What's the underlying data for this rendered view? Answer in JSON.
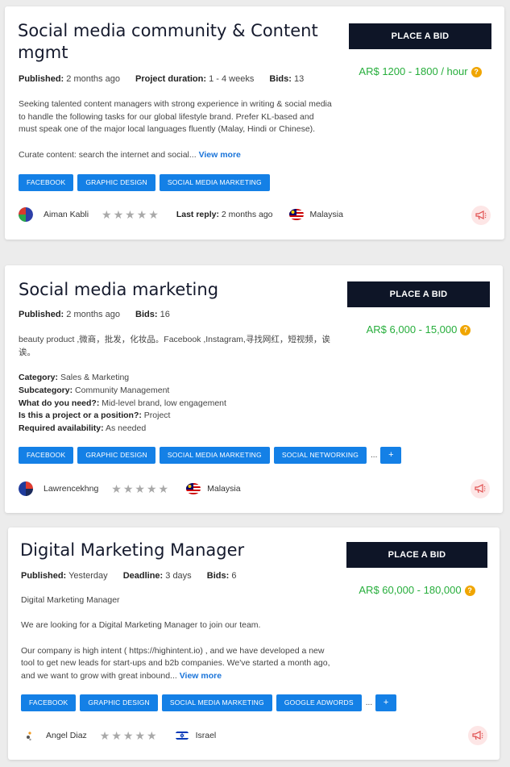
{
  "colors": {
    "page_bg": "#ececec",
    "tag_blue": "#1480e6",
    "bid_button": "#0e1527",
    "price_green": "#27ae3c",
    "help_orange": "#f0a500",
    "link_blue": "#1a74d9",
    "report_red": "#e05050"
  },
  "cards": [
    {
      "title_line1": "Social media community & Content",
      "title_line2": "mgmt",
      "published_label": "Published:",
      "published_value": "2 months ago",
      "duration_label": "Project duration:",
      "duration_value": "1 - 4 weeks",
      "bids_label": "Bids:",
      "bids_value": "13",
      "desc_lines": [
        "Seeking talented content managers with strong experience in writing & social media",
        "to handle the following tasks for our global lifestyle brand. Prefer KL-based and",
        "must speak one of the major local languages fluently (Malay, Hindi or Chinese)."
      ],
      "desc_tail": "Curate content: search the internet and social...",
      "view_more": "View more",
      "tags": [
        "FACEBOOK",
        "GRAPHIC DESIGN",
        "SOCIAL MEDIA MARKETING"
      ],
      "user": "Aiman Kabli",
      "rating_stars": 5,
      "rating_value": 0,
      "last_reply_label": "Last reply:",
      "last_reply_value": "2 months ago",
      "country": "Malaysia",
      "bid_button": "PLACE A BID",
      "price": "AR$ 1200 - 1800 / hour",
      "help_icon": "?"
    },
    {
      "title": "Social media marketing",
      "published_label": "Published:",
      "published_value": "2 months ago",
      "bids_label": "Bids:",
      "bids_value": "16",
      "desc_line1": "beauty product ,微商，批发，化妆品。Facebook ,Instagram,寻找网红，短视频，诶",
      "desc_line2": "诶。",
      "details": [
        {
          "label": "Category:",
          "value": "Sales & Marketing"
        },
        {
          "label": "Subcategory:",
          "value": "Community Management"
        },
        {
          "label": "What do you need?:",
          "value": "Mid-level brand, low engagement"
        },
        {
          "label": "Is this a project or a position?:",
          "value": "Project"
        },
        {
          "label": "Required availability:",
          "value": "As needed"
        }
      ],
      "tags": [
        "FACEBOOK",
        "GRAPHIC DESIGN",
        "SOCIAL MEDIA MARKETING",
        "SOCIAL NETWORKING"
      ],
      "ellipsis": "...",
      "more_tags": "+",
      "user": "Lawrencekhng",
      "rating_stars": 5,
      "rating_value": 0,
      "country": "Malaysia",
      "bid_button": "PLACE A BID",
      "price": "AR$ 6,000 - 15,000",
      "help_icon": "?"
    },
    {
      "title": "Digital Marketing Manager",
      "published_label": "Published:",
      "published_value": "Yesterday",
      "deadline_label": "Deadline:",
      "deadline_value": "3 days",
      "bids_label": "Bids:",
      "bids_value": "6",
      "desc_p1": "Digital Marketing Manager",
      "desc_p2": "We are looking for a Digital Marketing Manager to join our team.",
      "desc_p3_line1": "Our company is high intent ( https://highintent.io) , and we have developed a new",
      "desc_p3_line2": "tool to get new leads for start-ups and b2b companies. We've started a month ago,",
      "desc_p3_line3": "and we want to grow with great inbound...",
      "view_more": "View more",
      "tags": [
        "FACEBOOK",
        "GRAPHIC DESIGN",
        "SOCIAL MEDIA MARKETING",
        "GOOGLE ADWORDS"
      ],
      "ellipsis": "...",
      "more_tags": "+",
      "user": "Angel Diaz",
      "rating_stars": 5,
      "rating_value": 0,
      "country": "Israel",
      "bid_button": "PLACE A BID",
      "price": "AR$ 60,000 - 180,000",
      "help_icon": "?"
    }
  ]
}
